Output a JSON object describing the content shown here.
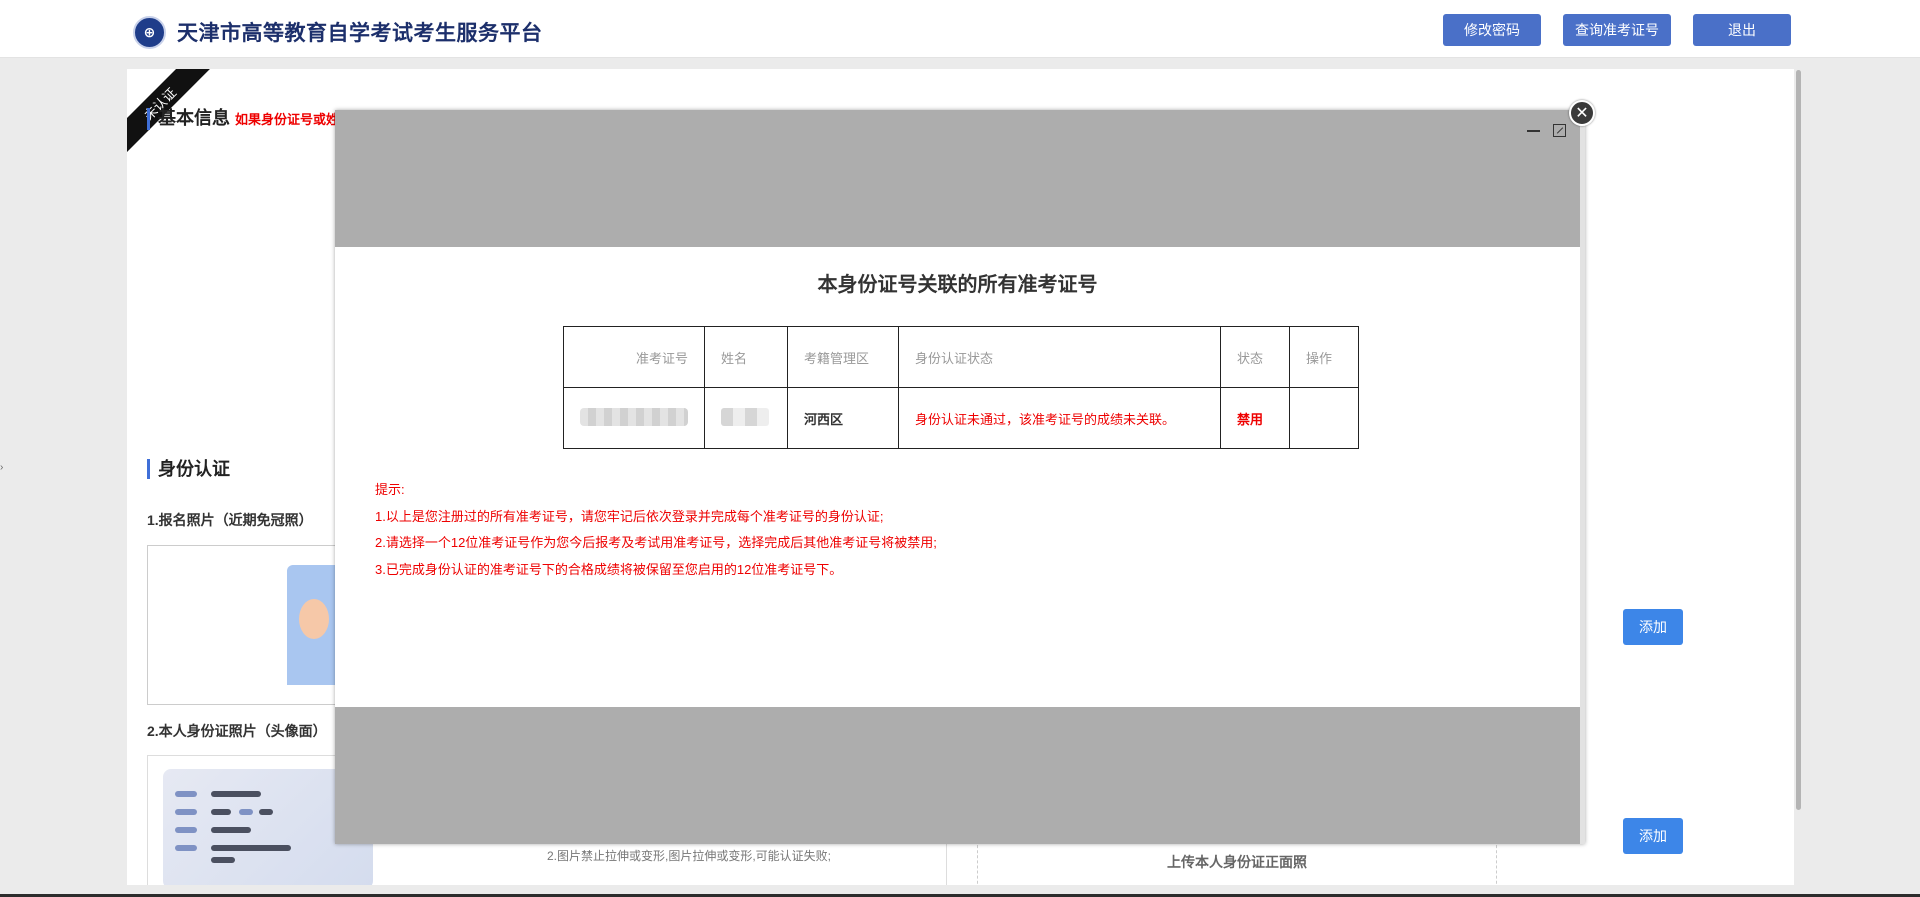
{
  "header": {
    "logo_text": "⊕",
    "title": "天津市高等教育自学考试考生服务平台",
    "buttons": [
      "修改密码",
      "查询准考证号",
      "退出"
    ]
  },
  "page": {
    "ribbon": "未认证",
    "basic_info": {
      "title": "基本信息",
      "note": "如果身份证号或姓"
    },
    "identity": {
      "title": "身份认证",
      "photo_label": "1.报名照片（近期免冠照）",
      "idcard_label": "2.本人身份证照片（头像面）",
      "idcard_tip": "2.图片禁止拉伸或变形,图片拉伸或变形,可能认证失败;",
      "upload_text": "上传本人身份证正面照"
    },
    "add_label": "添加"
  },
  "modal": {
    "title": "本身份证号关联的所有准考证号",
    "columns": [
      "准考证号",
      "姓名",
      "考籍管理区",
      "身份认证状态",
      "状态",
      "操作"
    ],
    "rows": [
      {
        "district": "河西区",
        "auth_status": "身份认证未通过，该准考证号的成绩未关联。",
        "status": "禁用",
        "action": ""
      }
    ],
    "tips": [
      "提示:",
      "1.以上是您注册过的所有准考证号，请您牢记后依次登录并完成每个准考证号的身份认证;",
      "2.请选择一个12位准考证号作为您今后报考及考试用准考证号，选择完成后其他准考证号将被禁用;",
      "3.已完成身份认证的准考证号下的合格成绩将被保留至您启用的12位准考证号下。"
    ]
  },
  "colors": {
    "header_button": "#4a70c8",
    "add_button": "#3d86e8",
    "alert_red": "#e00000",
    "accent_bar": "#3f6fd8"
  }
}
